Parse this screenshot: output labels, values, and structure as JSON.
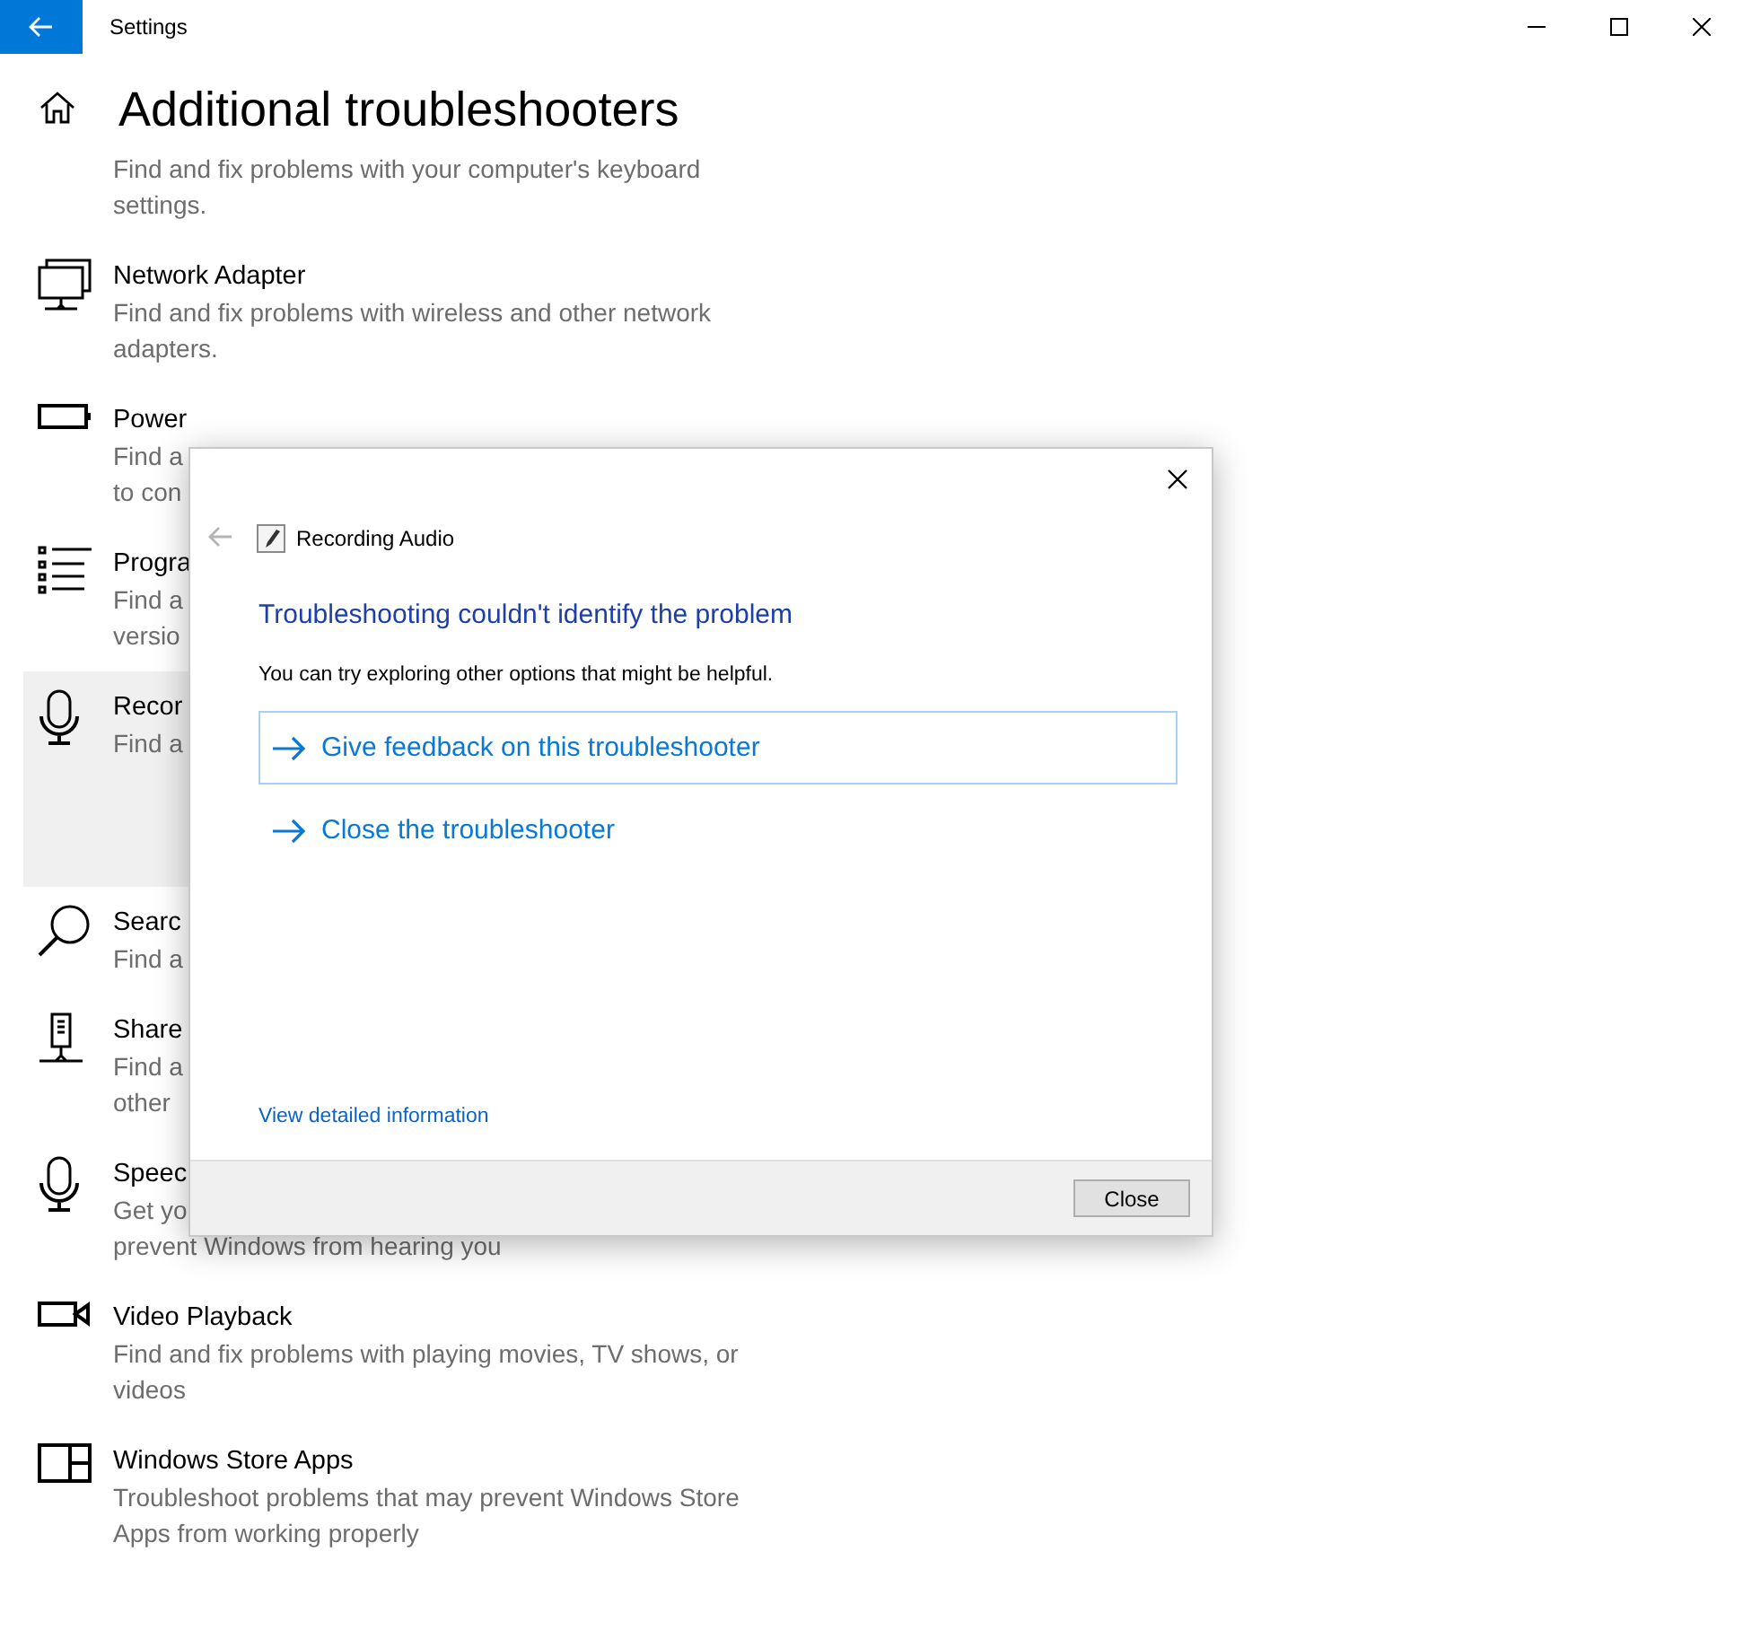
{
  "window": {
    "title": "Settings"
  },
  "page": {
    "title": "Additional troubleshooters"
  },
  "troubleshooters": [
    {
      "kind": "plain",
      "selected": false,
      "description": [
        "Find and fix problems with your computer's keyboard",
        "settings."
      ]
    },
    {
      "kind": "network",
      "selected": false,
      "title": "Network Adapter",
      "description": [
        "Find and fix problems with wireless and other network",
        "adapters."
      ]
    },
    {
      "kind": "battery",
      "selected": false,
      "title": "Power",
      "description": [
        "Find a",
        "to con"
      ]
    },
    {
      "kind": "list",
      "selected": false,
      "title": "Progra",
      "description": [
        "Find a",
        "versio"
      ]
    },
    {
      "kind": "mic",
      "selected": true,
      "title": "Recor",
      "description": [
        "Find a"
      ]
    },
    {
      "kind": "search",
      "selected": false,
      "title": "Searc",
      "description": [
        "Find a"
      ]
    },
    {
      "kind": "server",
      "selected": false,
      "title": "Share",
      "description": [
        "Find a",
        "other"
      ]
    },
    {
      "kind": "mic",
      "selected": false,
      "title": "Speec",
      "description": [
        "Get yo",
        "prevent Windows from hearing you"
      ]
    },
    {
      "kind": "camera",
      "selected": false,
      "title": "Video Playback",
      "description": [
        "Find and fix problems with playing movies, TV shows, or",
        "videos"
      ]
    },
    {
      "kind": "store",
      "selected": false,
      "title": "Windows Store Apps",
      "description": [
        "Troubleshoot problems that may prevent Windows Store",
        "Apps from working properly"
      ]
    }
  ],
  "dialog": {
    "title": "Recording Audio",
    "back_disabled": true,
    "heading": "Troubleshooting couldn't identify the problem",
    "message": "You can try exploring other options that might be helpful.",
    "options": [
      {
        "label": "Give feedback on this troubleshooter",
        "selected": true
      },
      {
        "label": "Close the troubleshooter",
        "selected": false
      }
    ],
    "details_link": "View detailed information",
    "close_button": "Close"
  }
}
